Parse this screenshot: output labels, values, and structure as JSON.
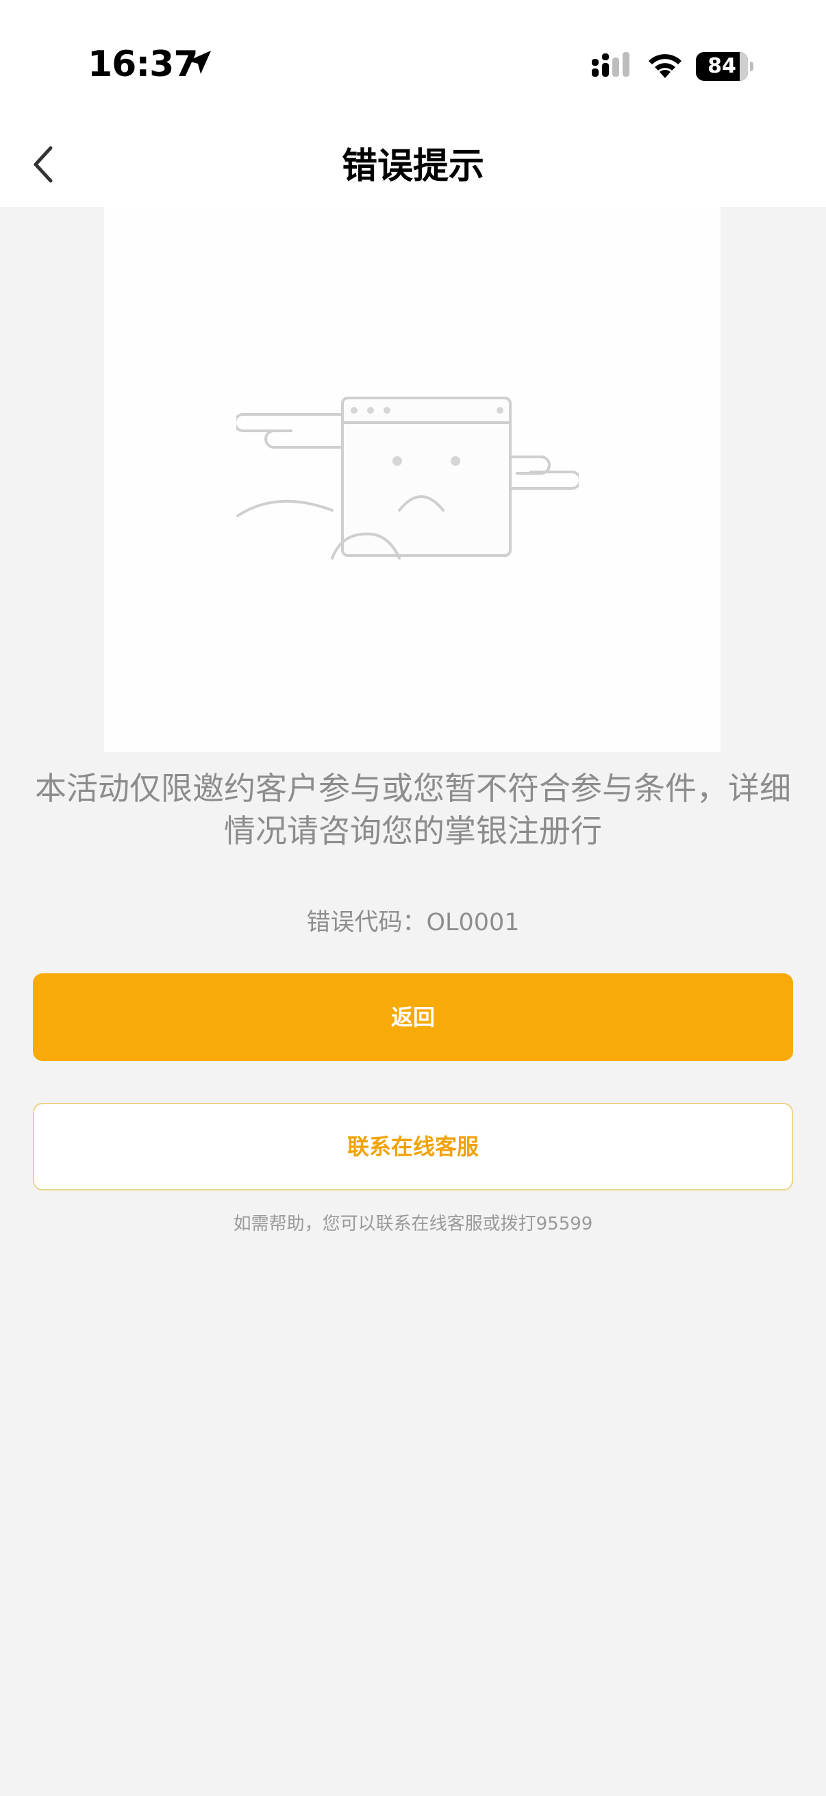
{
  "status_bar": {
    "time": "16:37",
    "battery_level": "84"
  },
  "nav": {
    "title": "错误提示"
  },
  "error": {
    "message": "本活动仅限邀约客户参与或您暂不符合参与条件，详细情况请咨询您的掌银注册行",
    "code": "错误代码：OL0001"
  },
  "actions": {
    "back_label": "返回",
    "contact_label": "联系在线客服"
  },
  "help": {
    "text": "如需帮助，您可以联系在线客服或拨打95599"
  },
  "colors": {
    "primary": "#f8aa08",
    "secondary_text": "#f2a20a",
    "page_background": "#f3f3f3"
  },
  "icons": {
    "location": "location-arrow-icon",
    "signal": "cellular-signal-icon",
    "wifi": "wifi-icon",
    "battery": "battery-icon",
    "back": "chevron-left-icon",
    "illustration": "sad-browser-window-illustration"
  }
}
